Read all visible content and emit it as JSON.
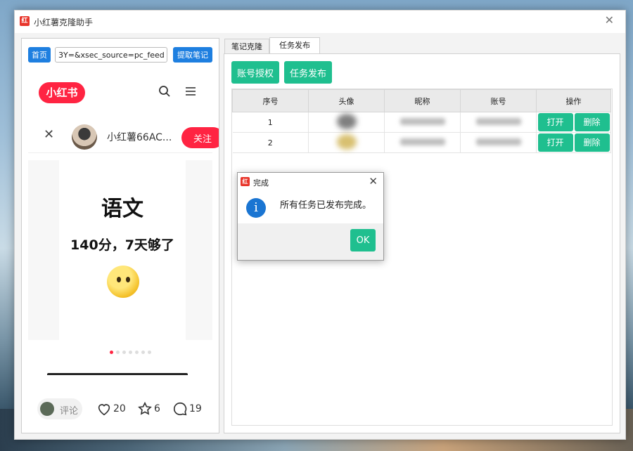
{
  "app": {
    "title": "小红薯克隆助手",
    "icon_glyph": "红"
  },
  "browser": {
    "home_label": "首页",
    "url_value": "3Y=&xsec_source=pc_feed",
    "extract_label": "提取笔记",
    "logo_text": "小红书",
    "author": "小红薯66AC...",
    "follow_label": "关注",
    "note_title": "语文",
    "note_subtitle": "140分，7天够了",
    "comment_placeholder": "评论",
    "likes": "20",
    "stars": "6",
    "comments": "19"
  },
  "tabs": [
    {
      "label": "笔记克隆"
    },
    {
      "label": "任务发布"
    }
  ],
  "toolbar": {
    "auth_label": "账号授权",
    "publish_label": "任务发布"
  },
  "table": {
    "headers": [
      "序号",
      "头像",
      "昵称",
      "账号",
      "操作"
    ],
    "rows": [
      {
        "index": "1",
        "open": "打开",
        "delete": "删除"
      },
      {
        "index": "2",
        "open": "打开",
        "delete": "删除"
      }
    ]
  },
  "dialog": {
    "title": "完成",
    "icon_glyph": "红",
    "message": "所有任务已发布完成。",
    "ok_label": "OK",
    "info_glyph": "i"
  },
  "colors": {
    "accent_green": "#1fbf8f",
    "brand_red": "#ff2442",
    "link_blue": "#1e7fe0"
  }
}
